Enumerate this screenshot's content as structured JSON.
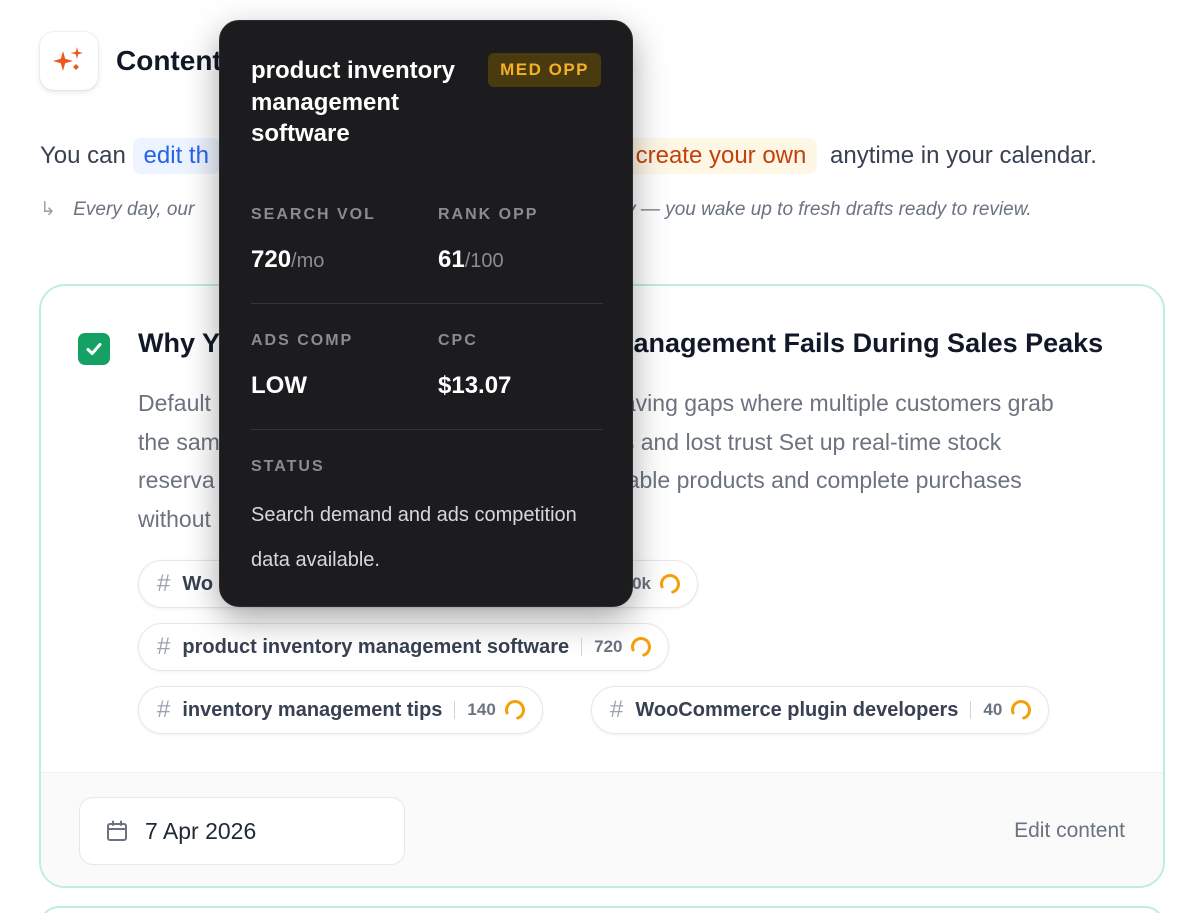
{
  "header": {
    "title": "Content"
  },
  "intro": {
    "prefix": "You can",
    "edit_link": "edit th",
    "create_link": "create your own",
    "suffix": "anytime in your calendar."
  },
  "subnote": {
    "part1": "Every day, our",
    "part2": "ay — you wake up to fresh drafts ready to review."
  },
  "card": {
    "checked": true,
    "title_start": "Why Y",
    "title_end": "lanagement Fails During Sales Peaks",
    "description_lines": [
      {
        "left": "Default",
        "right": "aving gaps where multiple customers grab"
      },
      {
        "left": "the sam",
        "right": "s and lost trust Set up real-time stock"
      },
      {
        "left": "reserva",
        "right": "able products and complete purchases"
      },
      {
        "left": "without",
        "right": ""
      }
    ],
    "tags": [
      {
        "keyword": "Wo",
        "volume": "0k"
      },
      {
        "keyword": "product inventory management software",
        "volume": "720"
      },
      {
        "keyword": "inventory management tips",
        "volume": "140"
      },
      {
        "keyword": "WooCommerce plugin developers",
        "volume": "40"
      }
    ],
    "date": "7 Apr 2026",
    "edit_label": "Edit content"
  },
  "tooltip": {
    "title": "product inventory management software",
    "badge": "MED OPP",
    "search_vol_label": "SEARCH VOL",
    "search_vol_value": "720",
    "search_vol_unit": "/mo",
    "rank_opp_label": "RANK OPP",
    "rank_opp_value": "61",
    "rank_opp_unit": "/100",
    "ads_comp_label": "ADS COMP",
    "ads_comp_value": "LOW",
    "cpc_label": "CPC",
    "cpc_value": "$13.07",
    "status_label": "STATUS",
    "status_text": "Search demand and ads competition data available."
  },
  "colors": {
    "accent_green": "#15a064",
    "card_border": "#bfeedd",
    "orange_accent": "#f5b026",
    "link_blue": "#2563eb",
    "link_orange": "#c2410c"
  },
  "icons": [
    "sparkles-icon",
    "arrow-return-icon",
    "check-icon",
    "hash-icon",
    "loading-ring-icon",
    "calendar-icon"
  ]
}
